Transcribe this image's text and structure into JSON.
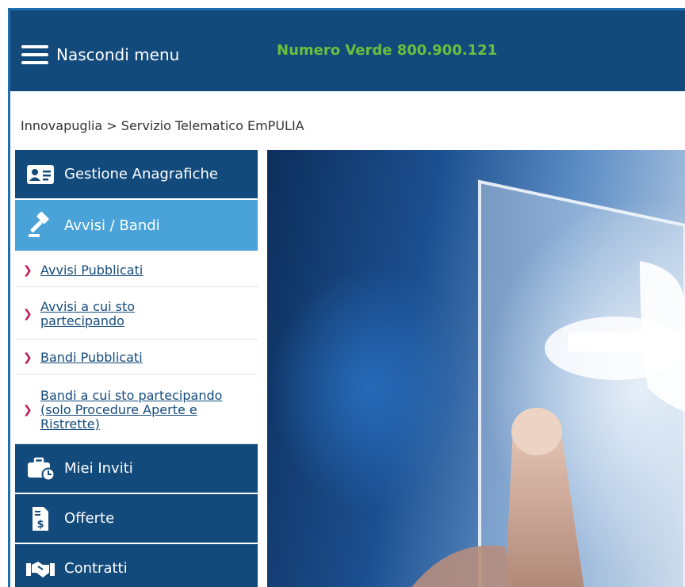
{
  "header": {
    "menu_label": "Nascondi menu",
    "toll_free": "Numero Verde 800.900.121",
    "toll_free_color": "#6cbf3c"
  },
  "breadcrumb": "Innovapuglia > Servizio Telematico EmPULIA",
  "sidebar": {
    "items": [
      {
        "label": "Gestione Anagrafiche",
        "icon": "id-card-icon"
      },
      {
        "label": "Avvisi / Bandi",
        "icon": "gavel-icon"
      },
      {
        "label": "Miei Inviti",
        "icon": "briefcase-clock-icon"
      },
      {
        "label": "Offerte",
        "icon": "invoice-dollar-icon"
      },
      {
        "label": "Contratti",
        "icon": "handshake-icon"
      }
    ],
    "subitems": [
      "Avvisi Pubblicati",
      "Avvisi a cui sto partecipando",
      "Bandi Pubblicati",
      "Bandi a cui sto partecipando (solo Procedure Aperte e Ristrette)"
    ]
  },
  "colors": {
    "header_bg": "#134a7c",
    "active_bg": "#4aa3d8",
    "chevron": "#c0185a"
  },
  "hero": {
    "description_icon": "touch-screen-image"
  }
}
